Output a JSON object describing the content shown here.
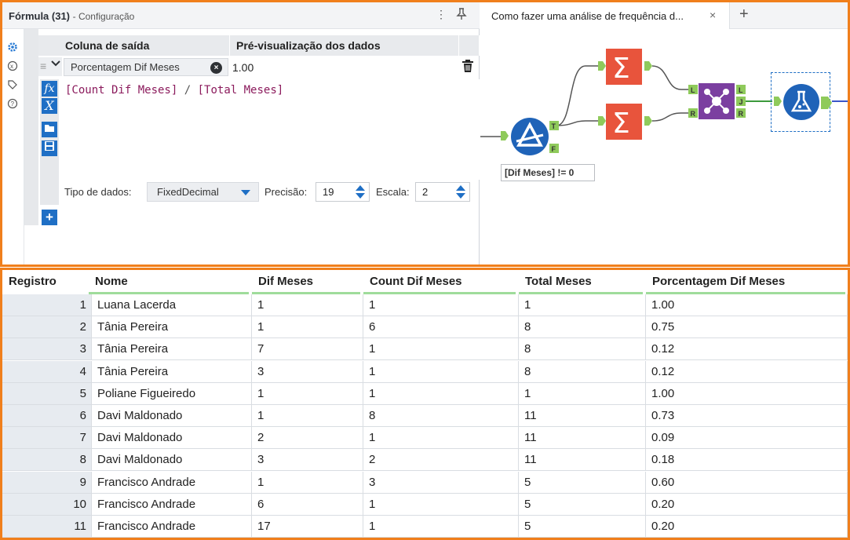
{
  "config_panel": {
    "title": "Fórmula (31)",
    "subtitle": "- Configuração",
    "columns": {
      "output": "Coluna de saída",
      "preview": "Pré-visualização dos dados"
    },
    "output_field": "Porcentagem Dif Meses",
    "preview_value": "1.00",
    "expression": {
      "field1": "[Count Dif Meses]",
      "operator": "/",
      "field2": "[Total Meses]"
    },
    "data_type_label": "Tipo de dados:",
    "data_type_value": "FixedDecimal",
    "precision_label": "Precisão:",
    "precision_value": "19",
    "scale_label": "Escala:",
    "scale_value": "2"
  },
  "canvas": {
    "tab_title": "Como fazer uma análise de frequência d...",
    "tab_close": "×",
    "tab_add": "+",
    "filter_label": "[Dif Meses] != 0"
  },
  "results": {
    "headers": [
      "Registro",
      "Nome",
      "Dif Meses",
      "Count Dif Meses",
      "Total Meses",
      "Porcentagem Dif Meses"
    ],
    "rows": [
      [
        "1",
        "Luana Lacerda",
        "1",
        "1",
        "1",
        "1.00"
      ],
      [
        "2",
        "Tânia Pereira",
        "1",
        "6",
        "8",
        "0.75"
      ],
      [
        "3",
        "Tânia Pereira",
        "7",
        "1",
        "8",
        "0.12"
      ],
      [
        "4",
        "Tânia Pereira",
        "3",
        "1",
        "8",
        "0.12"
      ],
      [
        "5",
        "Poliane Figueiredo",
        "1",
        "1",
        "1",
        "1.00"
      ],
      [
        "6",
        "Davi Maldonado",
        "1",
        "8",
        "11",
        "0.73"
      ],
      [
        "7",
        "Davi Maldonado",
        "2",
        "1",
        "11",
        "0.09"
      ],
      [
        "8",
        "Davi Maldonado",
        "3",
        "2",
        "11",
        "0.18"
      ],
      [
        "9",
        "Francisco Andrade",
        "1",
        "3",
        "5",
        "0.60"
      ],
      [
        "10",
        "Francisco Andrade",
        "6",
        "1",
        "5",
        "0.20"
      ],
      [
        "11",
        "Francisco Andrade",
        "17",
        "1",
        "5",
        "0.20"
      ]
    ]
  },
  "colors": {
    "frame": "#f07f1c",
    "tool_blue": "#1f6fc5",
    "summarize": "#e8543c",
    "join": "#7b3fa0",
    "filter": "#1f63b8",
    "anchor": "#8fca5b"
  },
  "icons": [
    "settings-icon",
    "variable-icon",
    "tag-icon",
    "help-icon",
    "pin-icon",
    "more-icon",
    "trash-icon",
    "function-icon",
    "variable-x-icon",
    "folder-icon",
    "save-icon",
    "add-icon"
  ]
}
